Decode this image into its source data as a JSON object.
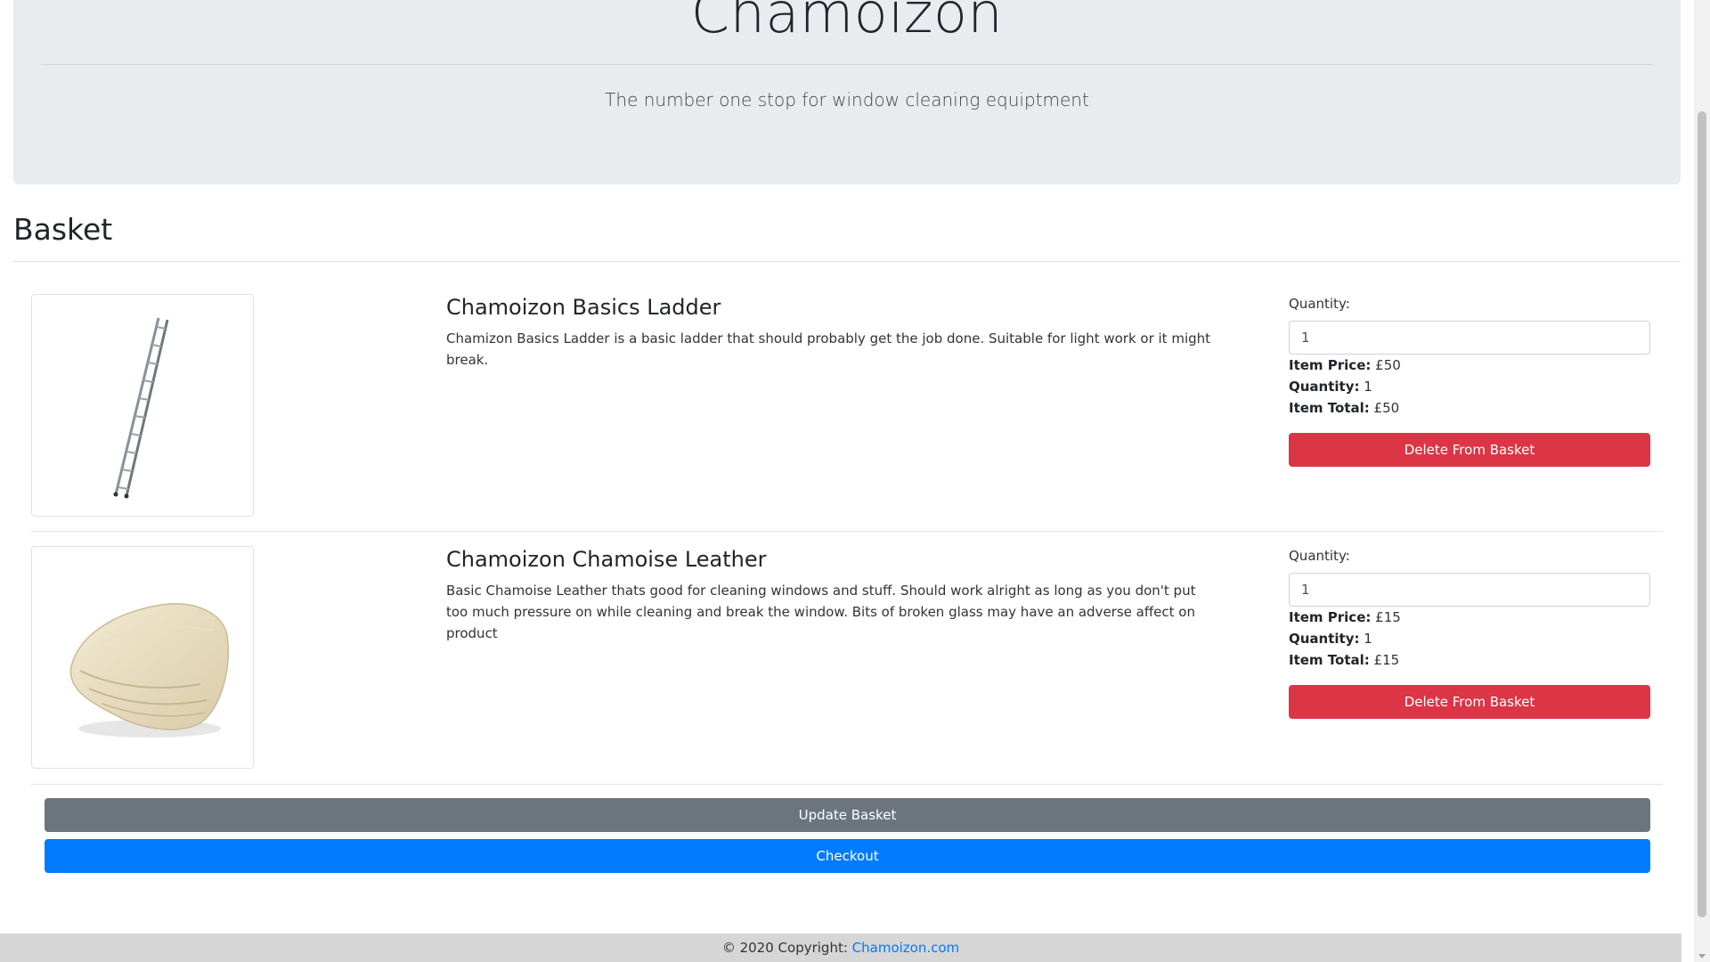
{
  "header": {
    "brand": "Chamoizon",
    "tagline": "The number one stop for window cleaning equiptment"
  },
  "basket": {
    "title": "Basket",
    "items": [
      {
        "name": "Chamoizon Basics Ladder",
        "description": "Chamizon Basics Ladder is a basic ladder that should probably get the job done. Suitable for light work or it might break.",
        "image_icon": "ladder-icon",
        "quantity_label": "Quantity:",
        "quantity_value": "1",
        "item_price_label": "Item Price:",
        "item_price": "£50",
        "quantity_summary_label": "Quantity:",
        "quantity_summary": "1",
        "item_total_label": "Item Total:",
        "item_total": "£50",
        "delete_label": "Delete From Basket"
      },
      {
        "name": "Chamoizon Chamoise Leather",
        "description": "Basic Chamoise Leather thats good for cleaning windows and stuff. Should work alright as long as you don't put too much pressure on while cleaning and break the window. Bits of broken glass may have an adverse affect on product",
        "image_icon": "chamois-leather-icon",
        "quantity_label": "Quantity:",
        "quantity_value": "1",
        "item_price_label": "Item Price:",
        "item_price": "£15",
        "quantity_summary_label": "Quantity:",
        "quantity_summary": "1",
        "item_total_label": "Item Total:",
        "item_total": "£15",
        "delete_label": "Delete From Basket"
      }
    ],
    "update_label": "Update Basket",
    "checkout_label": "Checkout"
  },
  "footer": {
    "copyright": "© 2020 Copyright: ",
    "link": "Chamoizon.com"
  },
  "colors": {
    "danger": "#dc3545",
    "secondary": "#6c757d",
    "primary": "#007bff",
    "jumbotron_bg": "#e9ecef"
  }
}
